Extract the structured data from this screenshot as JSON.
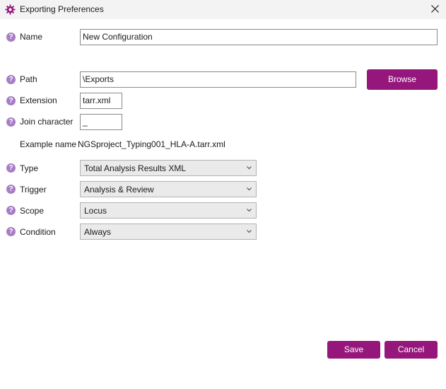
{
  "window": {
    "title": "Exporting Preferences",
    "icon": "gear-icon",
    "close_icon": "close-icon"
  },
  "help_glyph": "?",
  "fields": {
    "name": {
      "label": "Name",
      "value": "New Configuration"
    },
    "path": {
      "label": "Path",
      "value": "\\Exports",
      "browse_label": "Browse"
    },
    "extension": {
      "label": "Extension",
      "value": "tarr.xml"
    },
    "join_character": {
      "label": "Join character",
      "value": "_"
    },
    "example": {
      "label": "Example name",
      "value": "NGSproject_Typing001_HLA-A.tarr.xml"
    },
    "type": {
      "label": "Type",
      "value": "Total Analysis Results XML"
    },
    "trigger": {
      "label": "Trigger",
      "value": "Analysis & Review"
    },
    "scope": {
      "label": "Scope",
      "value": "Locus"
    },
    "condition": {
      "label": "Condition",
      "value": "Always"
    }
  },
  "footer": {
    "save_label": "Save",
    "cancel_label": "Cancel"
  },
  "colors": {
    "accent": "#96177b",
    "help_icon": "#a77dc4"
  }
}
